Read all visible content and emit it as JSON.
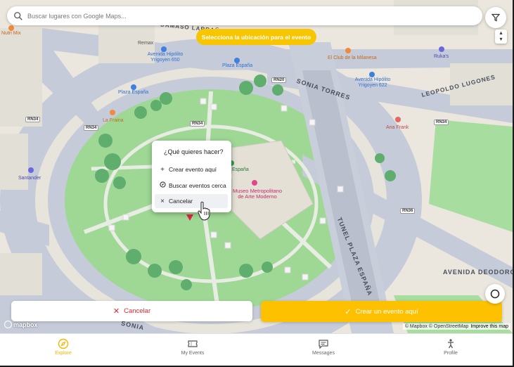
{
  "search": {
    "placeholder": "Buscar lugares con Google Maps..."
  },
  "banner": {
    "text": "Selecciona la ubicación para el evento"
  },
  "context_menu": {
    "title": "¿Qué quieres hacer?",
    "items": [
      {
        "label": "Crear evento aquí",
        "icon": "plus-icon"
      },
      {
        "label": "Buscar eventos cerca",
        "icon": "compass-icon"
      },
      {
        "label": "Cancelar",
        "icon": "close-icon"
      }
    ]
  },
  "actions": {
    "cancel_label": "Cancelar",
    "create_label": "Crear un evento aquí"
  },
  "map": {
    "roads": [
      "DAMASO LARRAÑAGA",
      "SONIA TORRES",
      "LEOPOLDO LUGONES",
      "TUNEL PLAZA ESPAÑA",
      "AVENIDA DEODORO",
      "SONIA"
    ],
    "shields": [
      "RN20",
      "RN34",
      "RN34",
      "RN34",
      "RN34",
      "RN36"
    ],
    "pois": [
      {
        "name": "Nutri Mix",
        "color": "#f08b3e"
      },
      {
        "name": "Remax",
        "color": "#7b6a5a"
      },
      {
        "name": "Avenida Hipólito Yrigoyen 650",
        "color": "#3f7fe0"
      },
      {
        "name": "Plaza España",
        "color": "#3f7fe0"
      },
      {
        "name": "El Club de la Milanesa",
        "color": "#f08b3e"
      },
      {
        "name": "Avenida Hipólito Yrigoyen 622",
        "color": "#3f7fe0"
      },
      {
        "name": "Ruka's",
        "color": "#6a6adf"
      },
      {
        "name": "Plaza España",
        "color": "#3f7fe0"
      },
      {
        "name": "La Fraina",
        "color": "#f08b3e"
      },
      {
        "name": "Ana Frank",
        "color": "#e06a6a"
      },
      {
        "name": "Santander",
        "color": "#6a6adf"
      },
      {
        "name": "Museo Metropolitano de Arte Moderno",
        "color": "#e0468a"
      },
      {
        "name": "España",
        "color": "#2f9e44"
      }
    ]
  },
  "mapbox_logo": "mapbox",
  "attribution": {
    "text": "© Mapbox © OpenStreetMap",
    "improve": "Improve this map"
  },
  "nav": [
    {
      "label": "Explore",
      "icon": "compass-icon",
      "active": true
    },
    {
      "label": "My Events",
      "icon": "ticket-icon",
      "active": false
    },
    {
      "label": "Messages",
      "icon": "message-icon",
      "active": false
    },
    {
      "label": "Profile",
      "icon": "person-icon",
      "active": false
    }
  ],
  "colors": {
    "accent": "#f7c600",
    "danger": "#e0262b",
    "park": "#a7dea0",
    "road": "#c9cedb"
  }
}
